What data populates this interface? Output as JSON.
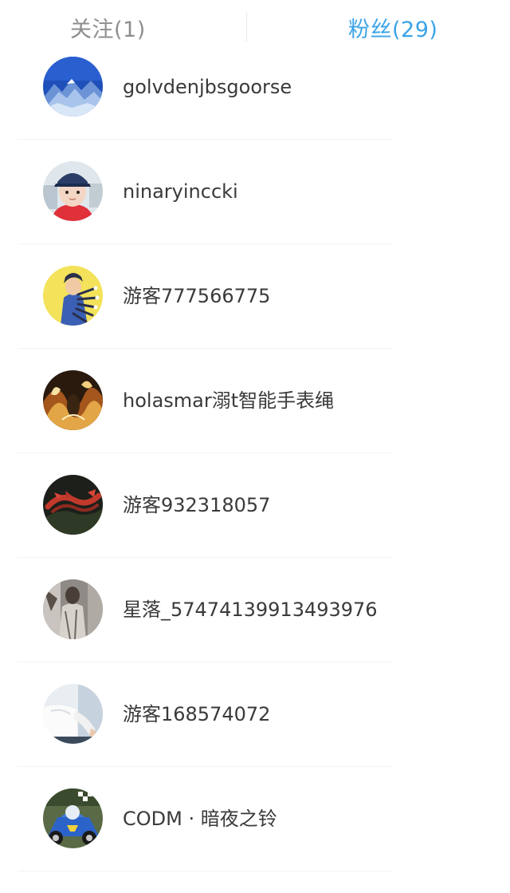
{
  "tabs": {
    "following_label": "关注(1)",
    "followers_label": "粉丝(29)"
  },
  "colors": {
    "active_tab": "#3aa3e8",
    "inactive_tab": "#8e8e8e",
    "name_text": "#3a3a3a"
  },
  "followers": [
    {
      "name": "golvdenjbsgoorse",
      "avatar": "blue-mountain-avatar"
    },
    {
      "name": "ninaryinccki",
      "avatar": "child-with-cap-avatar"
    },
    {
      "name": "游客777566775",
      "avatar": "cartoon-figure-yellow-avatar"
    },
    {
      "name": "holasmar溺t智能手表绳",
      "avatar": "fiery-abstract-avatar"
    },
    {
      "name": "游客932318057",
      "avatar": "red-dragon-avatar"
    },
    {
      "name": "星落_57474139913493976",
      "avatar": "grey-figure-avatar"
    },
    {
      "name": "游客168574072",
      "avatar": "white-sleeve-avatar"
    },
    {
      "name": "CODM · 暗夜之铃",
      "avatar": "kart-racer-avatar"
    }
  ]
}
